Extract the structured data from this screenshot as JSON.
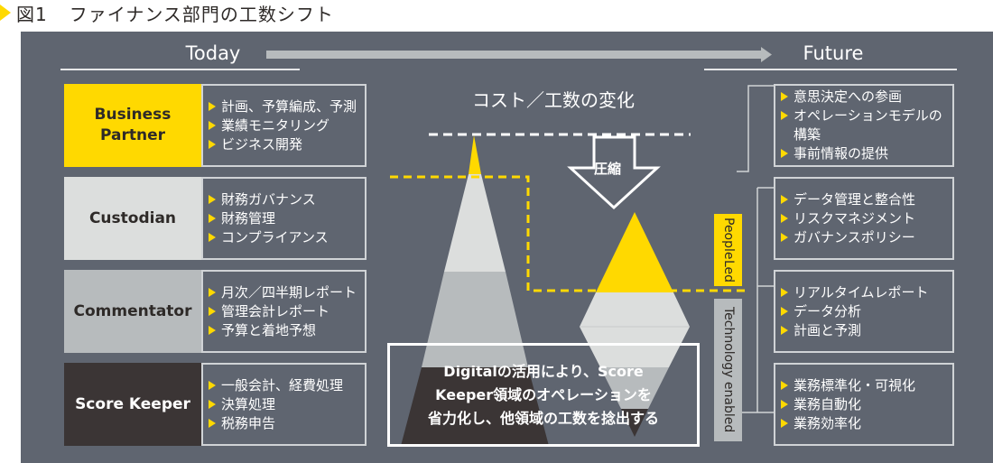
{
  "figure": {
    "number": "図1",
    "title": "ファイナンス部門の工数シフト"
  },
  "headers": {
    "today": "Today",
    "future": "Future",
    "center_title": "コスト／工数の変化",
    "compress_label": "圧縮"
  },
  "colors": {
    "panel_bg": "#5f6570",
    "accent_yellow": "#ffd900",
    "light_gray": "#dcdedd",
    "mid_gray": "#b7bbbd",
    "dark": "#3b3535"
  },
  "today_roles": [
    {
      "name": "Business Partner",
      "name_lines": [
        "Business",
        "Partner"
      ],
      "items": [
        "計画、予算編成、予測",
        "業績モニタリング",
        "ビジネス開発"
      ]
    },
    {
      "name": "Custodian",
      "name_lines": [
        "Custodian"
      ],
      "items": [
        "財務ガバナンス",
        "財務管理",
        "コンプライアンス"
      ]
    },
    {
      "name": "Commentator",
      "name_lines": [
        "Commentator"
      ],
      "items": [
        "月次／四半期レポート",
        "管理会計レポート",
        "予算と着地予想"
      ]
    },
    {
      "name": "Score Keeper",
      "name_lines": [
        "Score Keeper"
      ],
      "items": [
        "一般会計、経費処理",
        "決算処理",
        "税務申告"
      ]
    }
  ],
  "future_groups": [
    {
      "category": "People Led",
      "category_lines": [
        "People",
        "Led"
      ],
      "boxes": [
        {
          "items": [
            {
              "text": "意思決定への参画",
              "bullet": true
            },
            {
              "text": "オペレーションモデルの",
              "bullet": true
            },
            {
              "text": "構築",
              "bullet": false
            },
            {
              "text": "事前情報の提供",
              "bullet": true
            }
          ]
        }
      ]
    },
    {
      "category": "Technology enabled",
      "category_lines": [
        "Technology enabled"
      ],
      "boxes": [
        {
          "items": [
            {
              "text": "データ管理と整合性",
              "bullet": true
            },
            {
              "text": "リスクマネジメント",
              "bullet": true
            },
            {
              "text": "ガバナンスポリシー",
              "bullet": true
            }
          ]
        },
        {
          "items": [
            {
              "text": "リアルタイムレポート",
              "bullet": true
            },
            {
              "text": "データ分析",
              "bullet": true
            },
            {
              "text": "計画と予測",
              "bullet": true
            }
          ]
        },
        {
          "items": [
            {
              "text": "業務標準化・可視化",
              "bullet": true
            },
            {
              "text": "業務自動化",
              "bullet": true
            },
            {
              "text": "業務効率化",
              "bullet": true
            }
          ]
        }
      ]
    }
  ],
  "callout": {
    "lines": [
      "Digitalの活用により、Score",
      "Keeper領域のオペレーションを",
      "省力化し、他領域の工数を捻出する"
    ]
  }
}
